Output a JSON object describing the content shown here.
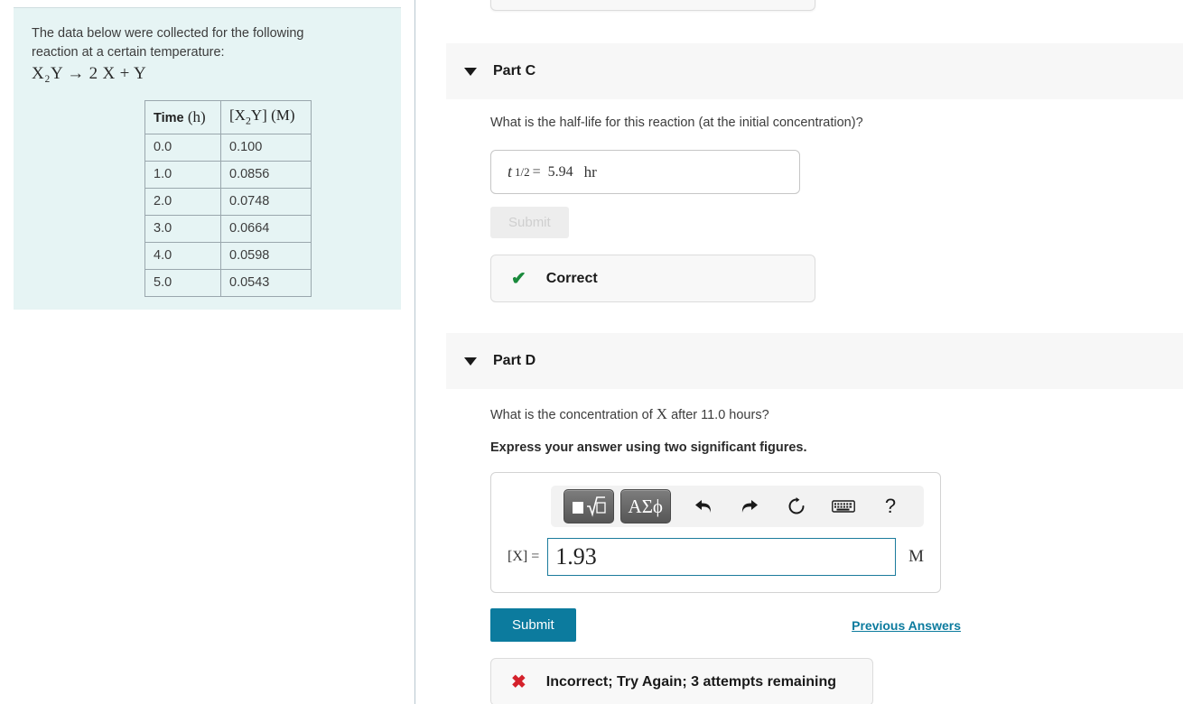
{
  "problem": {
    "intro_line1": "The data below were collected for the following",
    "intro_line2": "reaction at a certain temperature:",
    "equation": "X₂Y → 2 X + Y",
    "table": {
      "headers": [
        "Time (h)",
        "[X₂Y] (M)"
      ],
      "rows": [
        [
          "0.0",
          "0.100"
        ],
        [
          "1.0",
          "0.0856"
        ],
        [
          "2.0",
          "0.0748"
        ],
        [
          "3.0",
          "0.0664"
        ],
        [
          "4.0",
          "0.0598"
        ],
        [
          "5.0",
          "0.0543"
        ]
      ]
    }
  },
  "part_c": {
    "title": "Part C",
    "question": "What is the half-life for this reaction (at the initial concentration)?",
    "answer_symbol": "t",
    "answer_subscript": "1/2",
    "answer_equals": "=",
    "answer_value": "5.94",
    "answer_unit": "hr",
    "submit_label": "Submit",
    "feedback_label": "Correct",
    "feedback_icon": "check-icon",
    "feedback_color": "#1a8a3c"
  },
  "part_d": {
    "title": "Part D",
    "question_pre": "What is the concentration of ",
    "question_var": "X",
    "question_post": " after 11.0 hours?",
    "instruction": "Express your answer using two significant figures.",
    "toolbar": {
      "template_button": "math-template-button",
      "greek_button": "ΑΣϕ",
      "undo": "undo-icon",
      "redo": "redo-icon",
      "reset": "reset-icon",
      "keyboard": "keyboard-icon",
      "help": "?"
    },
    "entry_label": "[X] =",
    "entry_value": "1.93",
    "entry_unit": "M",
    "submit_label": "Submit",
    "previous_answers_label": "Previous Answers",
    "feedback_label": "Incorrect; Try Again; 3 attempts remaining",
    "feedback_icon": "x-icon",
    "feedback_color": "#d4212b"
  },
  "colors": {
    "panel_background": "#e6f4f4",
    "accent_teal": "#0c7b9e",
    "header_background": "#f7f7f7",
    "correct_green": "#1a8a3c",
    "incorrect_red": "#d4212b",
    "focus_border": "#1b7b9c"
  }
}
